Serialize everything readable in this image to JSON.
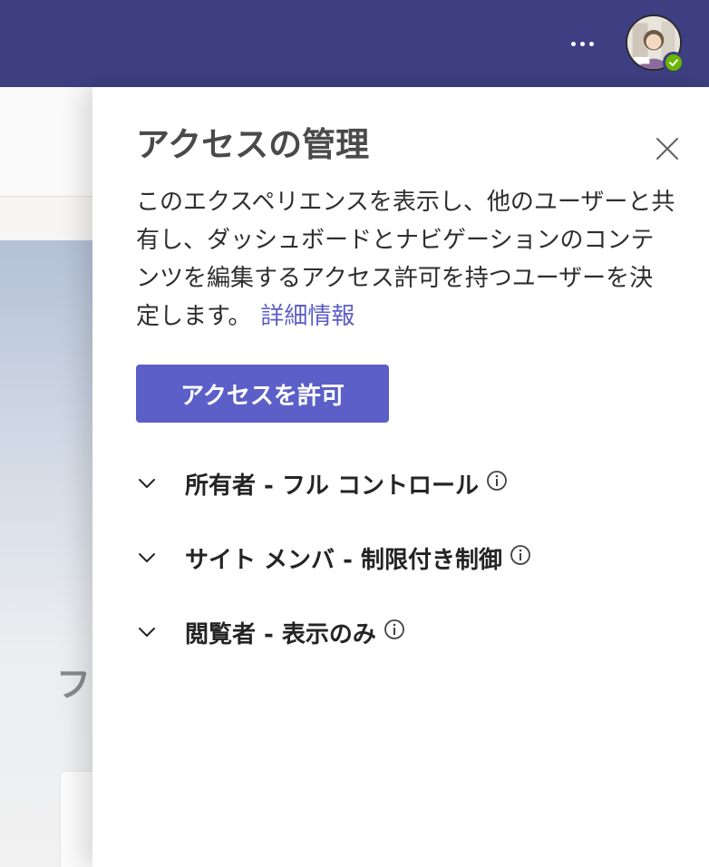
{
  "topbar": {
    "more_icon": "more-horizontal-icon",
    "avatar_icon": "user-avatar",
    "presence": {
      "status_icon": "available-check-icon",
      "color": "#6bb700"
    },
    "background": "#3d3f82"
  },
  "background_page": {
    "partial_heading": "フ"
  },
  "panel": {
    "title": "アクセスの管理",
    "close_icon": "close-icon",
    "description": "このエクスペリエンスを表示し、他のユーザーと共有し、ダッシュボードとナビゲーションのコンテンツを編集するアクセス許可を持つユーザーを決定します。",
    "learn_more_label": "詳細情報",
    "grant_button_label": "アクセスを許可",
    "accent_color": "#5b5fc7",
    "groups": [
      {
        "label": "所有者 - フル コントロール",
        "icon": "chevron-down-icon",
        "info_icon": "info-icon"
      },
      {
        "label": "サイト メンバ - 制限付き制御",
        "icon": "chevron-down-icon",
        "info_icon": "info-icon"
      },
      {
        "label": "閲覧者 - 表示のみ",
        "icon": "chevron-down-icon",
        "info_icon": "info-icon"
      }
    ]
  }
}
